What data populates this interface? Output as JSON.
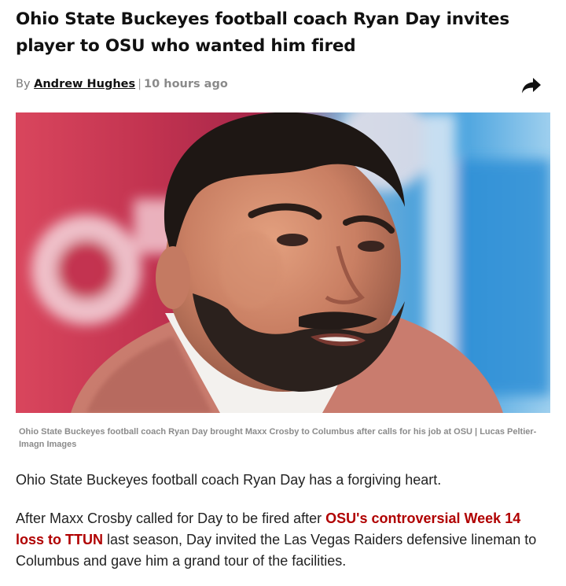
{
  "article": {
    "headline": "Ohio State Buckeyes football coach Ryan Day invites player to OSU who wanted him fired",
    "byline": {
      "prefix": "By",
      "author": "Andrew Hughes",
      "separator": "|",
      "timestamp": "10 hours ago"
    },
    "share_icon": "share-arrow-icon",
    "hero_image": {
      "alt": "Ohio State Buckeyes football coach Ryan Day",
      "caption": "Ohio State Buckeyes football coach Ryan Day brought Maxx Crosby to Columbus after calls for his job at OSU | Lucas Peltier-Imagn Images"
    },
    "paragraphs": {
      "p1": "Ohio State Buckeyes football coach Ryan Day has a forgiving heart.",
      "p2_before": "After Maxx Crosby called for Day to be fired after ",
      "p2_link": "OSU's controversial Week 14 loss to TTUN",
      "p2_after": " last season, Day invited the Las Vegas Raiders defensive lineman to Columbus and gave him a grand tour of the facilities."
    },
    "colors": {
      "link": "#b00000",
      "headline": "#111111",
      "body_text": "#222222",
      "caption": "#8b8b8b"
    }
  }
}
